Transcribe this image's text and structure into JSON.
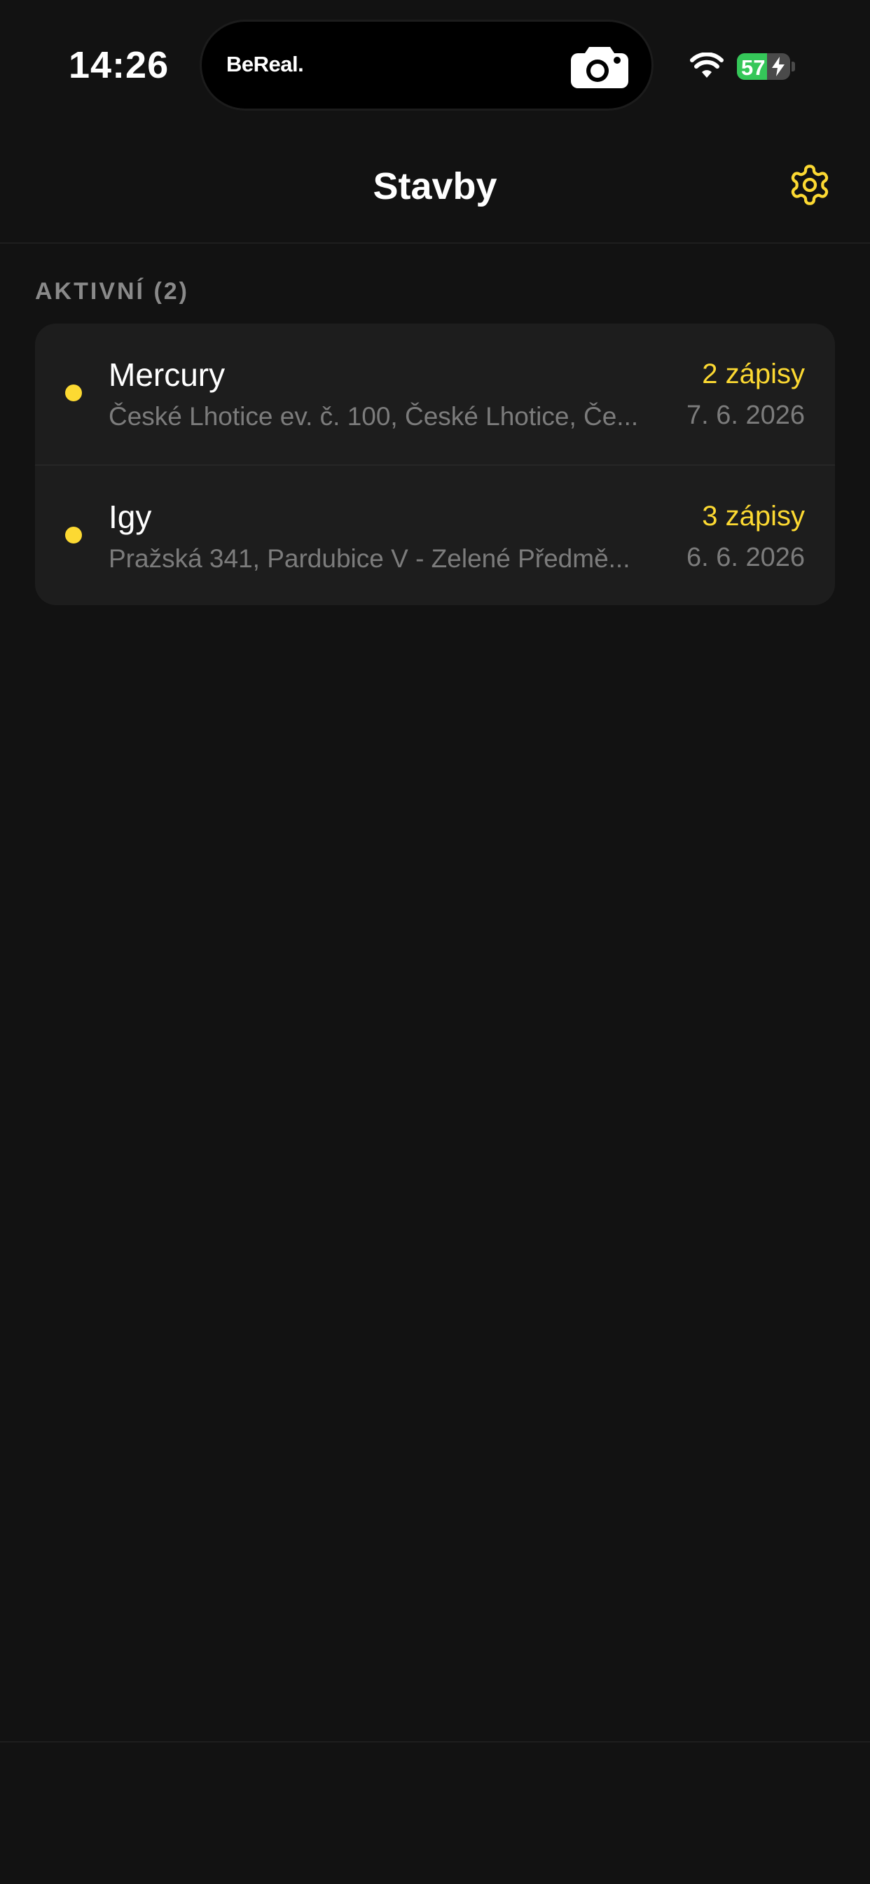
{
  "status_bar": {
    "time": "14:26",
    "live_activity_app": "BeReal.",
    "live_activity_icon": "camera-icon",
    "wifi_icon": "wifi-icon",
    "battery_percent": "57",
    "battery_level": 0.57,
    "battery_charging": true
  },
  "header": {
    "title": "Stavby",
    "settings_icon": "gear-icon",
    "accent_color": "#fcd932"
  },
  "section": {
    "title": "AKTIVNÍ (2)"
  },
  "projects": [
    {
      "name": "Mercury",
      "address": "České Lhotice ev. č. 100, České Lhotice, Če...",
      "count": "2 zápisy",
      "date": "7. 6. 2026",
      "status_color": "#fcd932"
    },
    {
      "name": "Igy",
      "address": "Pražská 341, Pardubice V - Zelené Předmě...",
      "count": "3 zápisy",
      "date": "6. 6. 2026",
      "status_color": "#fcd932"
    }
  ]
}
